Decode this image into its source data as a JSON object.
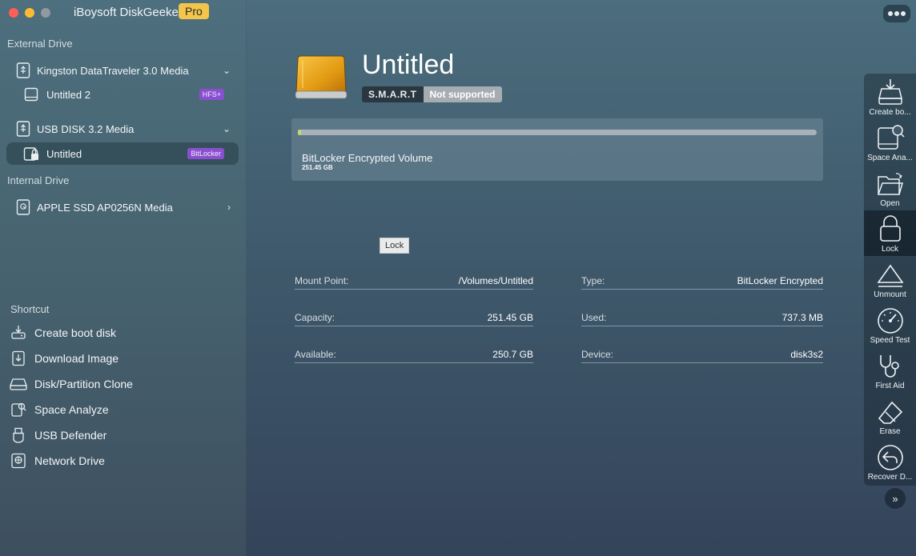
{
  "app": {
    "title": "iBoysoft DiskGeeker",
    "edition_badge": "Pro"
  },
  "sidebar": {
    "external_label": "External Drive",
    "internal_label": "Internal Drive",
    "shortcut_label": "Shortcut",
    "external_drives": [
      {
        "name": "Kingston DataTraveler 3.0 Media",
        "icon": "usb-drive-icon",
        "expanded": true,
        "volumes": [
          {
            "name": "Untitled 2",
            "badge": "HFS+",
            "icon": "volume-icon"
          }
        ]
      },
      {
        "name": "USB DISK 3.2 Media",
        "icon": "usb-drive-icon",
        "expanded": true,
        "volumes": [
          {
            "name": "Untitled",
            "badge": "BitLocker",
            "icon": "locked-volume-icon",
            "selected": true
          }
        ]
      }
    ],
    "internal_drives": [
      {
        "name": "APPLE SSD AP0256N Media",
        "icon": "internal-disk-icon",
        "expanded": false
      }
    ],
    "shortcuts": [
      {
        "label": "Create boot disk",
        "icon": "boot-disk-icon"
      },
      {
        "label": "Download Image",
        "icon": "download-image-icon"
      },
      {
        "label": "Disk/Partition Clone",
        "icon": "clone-icon"
      },
      {
        "label": "Space Analyze",
        "icon": "space-analyze-icon"
      },
      {
        "label": "USB Defender",
        "icon": "usb-defender-icon"
      },
      {
        "label": "Network Drive",
        "icon": "network-drive-icon"
      }
    ]
  },
  "main": {
    "volume_title": "Untitled",
    "smart_label": "S.M.A.R.T",
    "smart_value": "Not supported",
    "volume_type_label": "BitLocker Encrypted Volume",
    "volume_size": "251.45 GB",
    "usage_fraction": 0.003,
    "tooltip": "Lock",
    "info": {
      "mount_point": {
        "label": "Mount Point:",
        "value": "/Volumes/Untitled"
      },
      "type": {
        "label": "Type:",
        "value": "BitLocker Encrypted"
      },
      "capacity": {
        "label": "Capacity:",
        "value": "251.45 GB"
      },
      "used": {
        "label": "Used:",
        "value": "737.3 MB"
      },
      "available": {
        "label": "Available:",
        "value": "250.7 GB"
      },
      "device": {
        "label": "Device:",
        "value": "disk3s2"
      }
    }
  },
  "toolbar": {
    "tools": [
      {
        "label": "Create bo...",
        "icon": "create-boot-disk-icon"
      },
      {
        "label": "Space Ana...",
        "icon": "space-analyze-icon"
      },
      {
        "label": "Open",
        "icon": "open-folder-icon"
      },
      {
        "label": "Lock",
        "icon": "lock-icon",
        "active": true
      },
      {
        "label": "Unmount",
        "icon": "unmount-icon"
      },
      {
        "label": "Speed Test",
        "icon": "speed-test-icon"
      },
      {
        "label": "First Aid",
        "icon": "first-aid-icon"
      },
      {
        "label": "Erase",
        "icon": "erase-icon"
      },
      {
        "label": "Recover D...",
        "icon": "recover-data-icon"
      }
    ],
    "expand_icon": "double-chevron-right-icon",
    "more_icon": "more-icon"
  },
  "colors": {
    "pro_badge": "#f3c64b",
    "bitlocker_badge": "#8a4fd0",
    "hfs_badge": "#8a4fd0",
    "usage_bar_fill": "#c8d46a"
  }
}
